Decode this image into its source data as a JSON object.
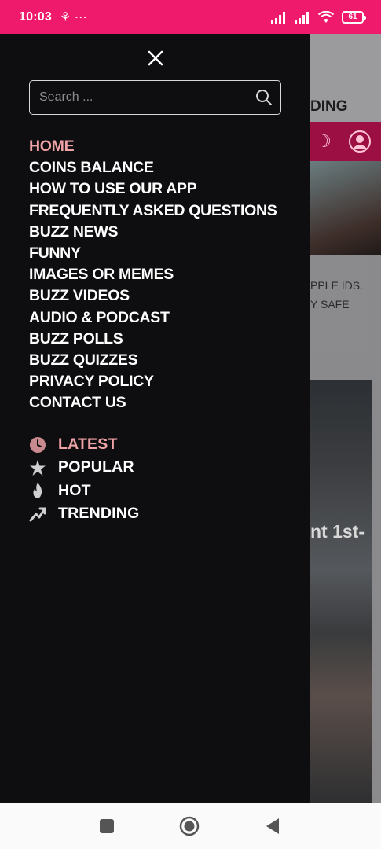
{
  "status_bar": {
    "time": "10:03",
    "left_icons": "⚘ ⋯",
    "battery": "61"
  },
  "drawer": {
    "search": {
      "placeholder": "Search ..."
    },
    "menu": [
      {
        "label": "HOME",
        "active": true
      },
      {
        "label": "COINS BALANCE"
      },
      {
        "label": "HOW TO USE OUR APP"
      },
      {
        "label": "FREQUENTLY ASKED QUESTIONS"
      },
      {
        "label": "BUZZ NEWS"
      },
      {
        "label": "FUNNY"
      },
      {
        "label": "IMAGES OR MEMES"
      },
      {
        "label": "BUZZ VIDEOS"
      },
      {
        "label": "AUDIO & PODCAST"
      },
      {
        "label": "BUZZ POLLS"
      },
      {
        "label": "BUZZ QUIZZES"
      },
      {
        "label": "PRIVACY POLICY"
      },
      {
        "label": "CONTACT US"
      }
    ],
    "sub_menu": [
      {
        "label": "LATEST",
        "icon": "clock-icon",
        "active": true
      },
      {
        "label": "POPULAR",
        "icon": "star-icon"
      },
      {
        "label": "HOT",
        "icon": "flame-icon"
      },
      {
        "label": "TRENDING",
        "icon": "trending-icon"
      }
    ]
  },
  "background_app": {
    "header_partial": "DING",
    "card_partial_line1": "PPLE IDS.",
    "card_partial_line2": "Y SAFE",
    "headline_partial": "nt 1st-"
  },
  "colors": {
    "status_bar": "#ef1a6b",
    "drawer_bg": "#0e0e10",
    "active": "#f0a3a6"
  }
}
